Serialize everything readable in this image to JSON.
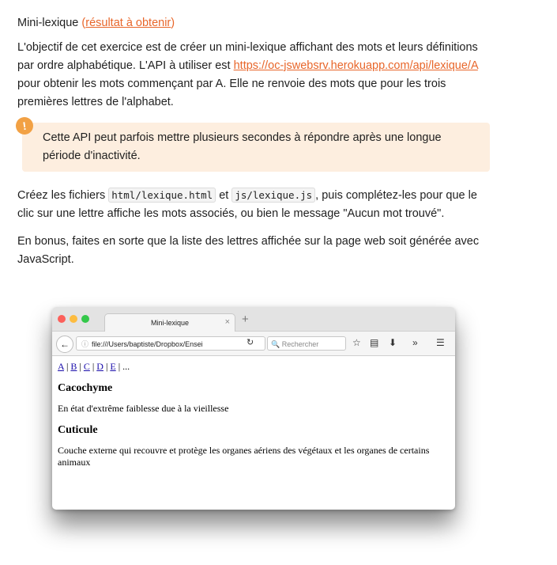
{
  "heading": {
    "title": "Mini-lexique",
    "paren_open": "(",
    "link": "résultat à obtenir",
    "paren_close": ")"
  },
  "intro": {
    "before_link": "L'objectif de cet exercice est de créer un mini-lexique affichant des mots et leurs définitions par ordre alphabétique. L'API à utiliser est ",
    "link": "https://oc-jswebsrv.herokuapp.com/api/lexique/A",
    "after_link": " pour obtenir les mots commençant par A. Elle ne renvoie des mots que pour les trois premières lettres de l'alphabet."
  },
  "warning": {
    "icon": "!",
    "text": "Cette API peut parfois mettre plusieurs secondes à répondre après une longue période d'inactivité."
  },
  "instructions": {
    "part1": "Créez les fichiers ",
    "code1": "html/lexique.html",
    "part2": " et ",
    "code2": "js/lexique.js",
    "part3": ", puis complétez-les pour que le clic sur une lettre affiche les mots associés, ou bien le message \"Aucun mot trouvé\"."
  },
  "bonus": "En bonus, faites en sorte que la liste des lettres affichée sur la page web soit générée avec JavaScript.",
  "browser": {
    "tab_title": "Mini-lexique",
    "tab_close": "×",
    "new_tab": "+",
    "url": "file:///Users/baptiste/Dropbox/Ensei",
    "search_placeholder": "Rechercher",
    "letters": [
      "A",
      "B",
      "C",
      "D",
      "E"
    ],
    "separator": " | ",
    "ellipsis": " | ...",
    "entries": [
      {
        "word": "Cacochyme",
        "definition": "En état d'extrême faiblesse due à la vieillesse"
      },
      {
        "word": "Cuticule",
        "definition": "Couche externe qui recouvre et protège les organes aériens des végétaux et les organes de certains animaux"
      }
    ]
  }
}
